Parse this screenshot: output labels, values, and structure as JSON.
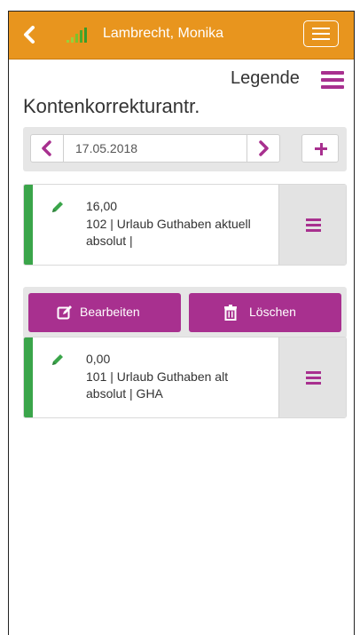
{
  "header": {
    "user_name": "Lambrecht, Monika"
  },
  "legend": {
    "label": "Legende"
  },
  "page": {
    "title": "Kontenkorrekturantr."
  },
  "date_nav": {
    "date": "17.05.2018"
  },
  "entries": [
    {
      "value": "16,00",
      "description": "102 | Urlaub Guthaben aktuell absolut |",
      "status_color": "#3aa54a"
    },
    {
      "value": "0,00",
      "description": "101 | Urlaub Guthaben alt absolut | GHA",
      "status_color": "#3aa54a"
    }
  ],
  "actions": {
    "edit_label": "Bearbeiten",
    "delete_label": "Löschen"
  },
  "colors": {
    "header": "#e8951e",
    "accent": "#a8308f",
    "status_ok": "#3aa54a"
  },
  "icons": {
    "back": "chevron-left-icon",
    "signal": "signal-icon",
    "menu": "hamburger-icon",
    "legend": "legend-menu-icon",
    "prev": "chevron-left-icon",
    "next": "chevron-right-icon",
    "add": "plus-icon",
    "pencil": "pencil-icon",
    "edit": "edit-icon",
    "delete": "trash-icon"
  }
}
